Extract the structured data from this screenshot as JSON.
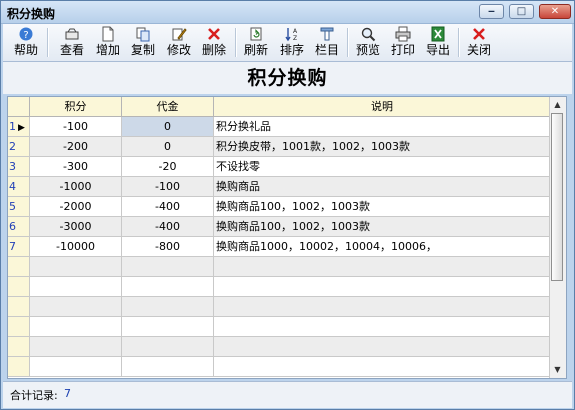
{
  "window": {
    "title": "积分换购"
  },
  "window_buttons": {
    "minimize": "‒",
    "maximize": "□",
    "close": "✕"
  },
  "toolbar": {
    "items": [
      {
        "label": "帮助",
        "icon": "help-icon"
      },
      {
        "label": "查看",
        "icon": "view-icon"
      },
      {
        "label": "增加",
        "icon": "new-document-icon"
      },
      {
        "label": "复制",
        "icon": "copy-icon"
      },
      {
        "label": "修改",
        "icon": "edit-icon"
      },
      {
        "label": "删除",
        "icon": "delete-x-icon"
      },
      {
        "label": "刷新",
        "icon": "refresh-icon"
      },
      {
        "label": "排序",
        "icon": "sort-icon"
      },
      {
        "label": "栏目",
        "icon": "columns-icon"
      },
      {
        "label": "预览",
        "icon": "preview-magnifier-icon"
      },
      {
        "label": "打印",
        "icon": "printer-icon"
      },
      {
        "label": "导出",
        "icon": "excel-export-icon"
      },
      {
        "label": "关闭",
        "icon": "close-x-icon"
      }
    ]
  },
  "caption": "积分换购",
  "table": {
    "columns": [
      "积分",
      "代金",
      "说明"
    ],
    "rows": [
      {
        "idx": "1",
        "points": "-100",
        "cash": "0",
        "desc": "积分换礼品"
      },
      {
        "idx": "2",
        "points": "-200",
        "cash": "0",
        "desc": "积分换皮带，1001款，1002，1003款"
      },
      {
        "idx": "3",
        "points": "-300",
        "cash": "-20",
        "desc": "不设找零"
      },
      {
        "idx": "4",
        "points": "-1000",
        "cash": "-100",
        "desc": "换购商品"
      },
      {
        "idx": "5",
        "points": "-2000",
        "cash": "-400",
        "desc": "换购商品100，1002，1003款"
      },
      {
        "idx": "6",
        "points": "-3000",
        "cash": "-400",
        "desc": "换购商品100，1002，1003款"
      },
      {
        "idx": "7",
        "points": "-10000",
        "cash": "-800",
        "desc": "换购商品1000，10002，10004，10006，"
      }
    ],
    "selected_row": "1",
    "row_pointer": "▶"
  },
  "status": {
    "label": "合计记录:",
    "count": "7"
  },
  "colors": {
    "accent": "#2341b7",
    "header_bg": "#fbf7d8",
    "selected_bg": "#cdd9e8"
  }
}
